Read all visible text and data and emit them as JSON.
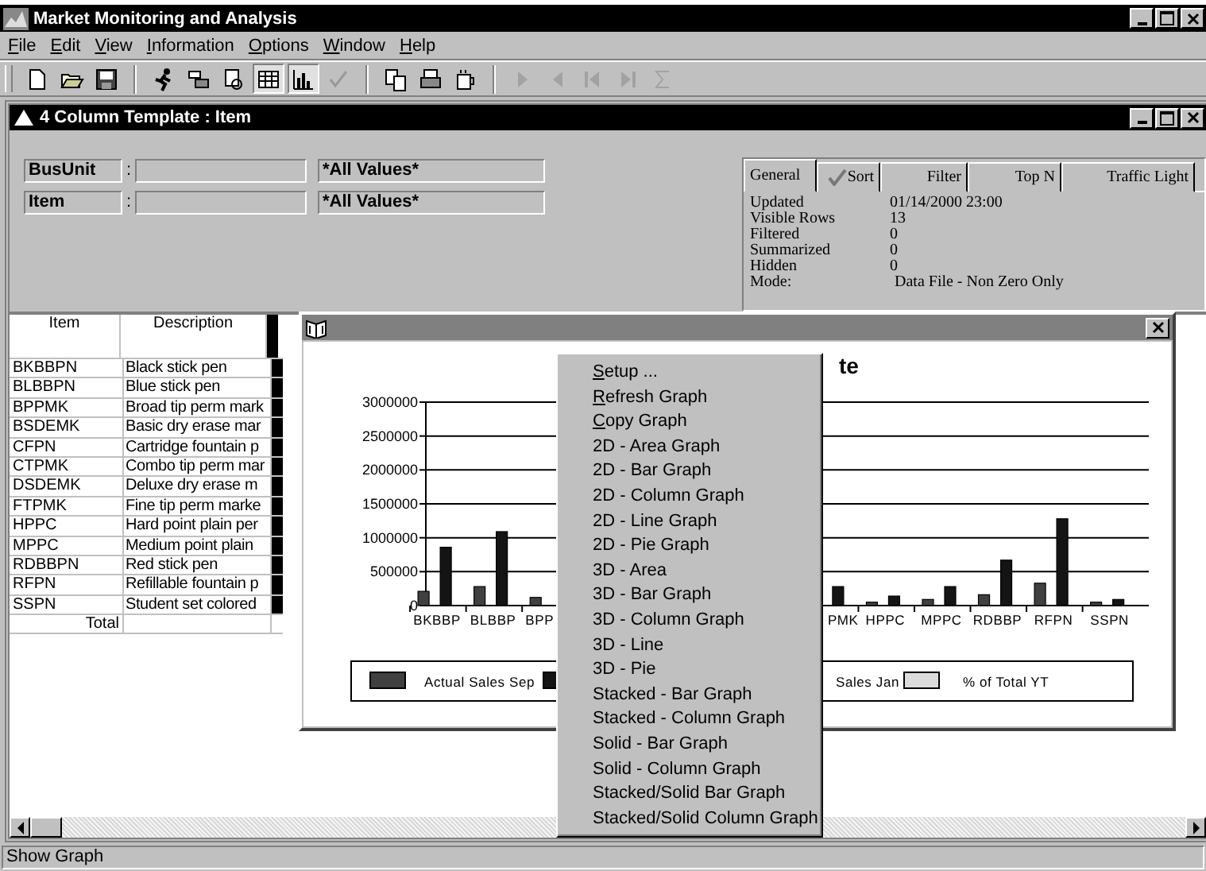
{
  "window": {
    "title": "Market Monitoring and Analysis"
  },
  "menu": [
    "File",
    "Edit",
    "View",
    "Information",
    "Options",
    "Window",
    "Help"
  ],
  "toolbar": [
    [
      {
        "kind": "new",
        "pressed": false,
        "disabled": false
      },
      {
        "kind": "open",
        "pressed": false,
        "disabled": false
      },
      {
        "kind": "save",
        "pressed": false,
        "disabled": false
      }
    ],
    [
      {
        "kind": "runner",
        "pressed": false,
        "disabled": false
      },
      {
        "kind": "tiles",
        "pressed": false,
        "disabled": false
      },
      {
        "kind": "form",
        "pressed": false,
        "disabled": false
      },
      {
        "kind": "table",
        "pressed": true,
        "disabled": false
      },
      {
        "kind": "chart",
        "pressed": true,
        "disabled": false
      },
      {
        "kind": "check",
        "pressed": false,
        "disabled": false
      }
    ],
    [
      {
        "kind": "copy",
        "pressed": false,
        "disabled": false
      },
      {
        "kind": "print",
        "pressed": false,
        "disabled": false
      },
      {
        "kind": "cup",
        "pressed": false,
        "disabled": false
      }
    ],
    [
      {
        "kind": "play",
        "pressed": false,
        "disabled": true
      },
      {
        "kind": "back",
        "pressed": false,
        "disabled": true
      },
      {
        "kind": "first",
        "pressed": false,
        "disabled": true
      },
      {
        "kind": "last",
        "pressed": false,
        "disabled": true
      },
      {
        "kind": "sum",
        "pressed": false,
        "disabled": true
      }
    ]
  ],
  "document": {
    "title": "4 Column Template : Item",
    "filters": [
      {
        "label": "BusUnit",
        "separator": ":",
        "value": "*All Values*"
      },
      {
        "label": "Item",
        "separator": ":",
        "value": "*All Values*"
      }
    ],
    "info_tabs": [
      {
        "label": "General",
        "selected": true,
        "kind": "plain"
      },
      {
        "label": "Sort",
        "selected": false,
        "kind": "checked"
      },
      {
        "label": "Filter",
        "selected": false,
        "kind": "plain"
      },
      {
        "label": "Top N",
        "selected": false,
        "kind": "plain"
      },
      {
        "label": "Traffic Light",
        "selected": false,
        "kind": "plain"
      }
    ],
    "info": [
      {
        "label": "Updated",
        "value": "01/14/2000 23:00"
      },
      {
        "label": "Visible Rows",
        "value": "13"
      },
      {
        "label": "Filtered",
        "value": "0"
      },
      {
        "label": "Summarized",
        "value": "0"
      },
      {
        "label": "Hidden",
        "value": "0"
      },
      {
        "label": "Mode:",
        "value": "Data File - Non Zero Only"
      }
    ],
    "table": {
      "columns": [
        "Item",
        "Description"
      ],
      "rows": [
        {
          "item": "BKBBPN",
          "description": "Black stick pen"
        },
        {
          "item": "BLBBPN",
          "description": "Blue stick pen"
        },
        {
          "item": "BPPMK",
          "description": "Broad tip perm mark"
        },
        {
          "item": "BSDEMK",
          "description": "Basic dry erase mar"
        },
        {
          "item": "CFPN",
          "description": "Cartridge fountain p"
        },
        {
          "item": "CTPMK",
          "description": "Combo tip perm mar"
        },
        {
          "item": "DSDEMK",
          "description": "Deluxe dry erase m"
        },
        {
          "item": "FTPMK",
          "description": "Fine tip perm marke"
        },
        {
          "item": "HPPC",
          "description": "Hard point plain per"
        },
        {
          "item": "MPPC",
          "description": "Medium point plain"
        },
        {
          "item": "RDBBPN",
          "description": "Red stick pen"
        },
        {
          "item": "RFPN",
          "description": "Refillable fountain p"
        },
        {
          "item": "SSPN",
          "description": "Student set colored"
        }
      ],
      "total_label": "Total"
    }
  },
  "graph": {
    "chart_data": {
      "type": "bar",
      "title": "te",
      "grid": true,
      "categories": [
        "BKBBP",
        "BLBBP",
        "BPP",
        null,
        null,
        null,
        null,
        "PMK",
        "HPPC",
        "MPPC",
        "RDBBP",
        "RFPN",
        "SSPN"
      ],
      "ylim": [
        0,
        3000000
      ],
      "yticks": [
        0,
        500000,
        1000000,
        1500000,
        2000000,
        2500000,
        3000000
      ],
      "series": [
        {
          "name": "Actual Sales Sep",
          "color": "#404040",
          "values": [
            210000,
            280000,
            120000,
            null,
            null,
            null,
            null,
            null,
            50000,
            90000,
            160000,
            330000,
            50000
          ]
        },
        {
          "name": "Sales Jan",
          "color": "#141414",
          "values": [
            860000,
            1090000,
            null,
            null,
            null,
            null,
            null,
            280000,
            140000,
            280000,
            670000,
            1280000,
            90000
          ]
        },
        {
          "name": "% of Total YT",
          "color": "#dcdcdc",
          "values": [
            null,
            null,
            null,
            null,
            null,
            null,
            null,
            null,
            null,
            null,
            null,
            null,
            null
          ]
        }
      ]
    }
  },
  "context_menu": [
    {
      "label": "Setup ...",
      "mnemonic": true
    },
    {
      "label": "Refresh Graph",
      "mnemonic": true
    },
    {
      "label": "Copy Graph",
      "mnemonic": true
    },
    {
      "label": "2D - Area Graph",
      "mnemonic": false
    },
    {
      "label": "2D - Bar Graph",
      "mnemonic": false
    },
    {
      "label": "2D - Column Graph",
      "mnemonic": false
    },
    {
      "label": "2D - Line Graph",
      "mnemonic": false
    },
    {
      "label": "2D - Pie Graph",
      "mnemonic": false
    },
    {
      "label": "3D - Area",
      "mnemonic": false
    },
    {
      "label": "3D - Bar Graph",
      "mnemonic": false
    },
    {
      "label": "3D - Column Graph",
      "mnemonic": false
    },
    {
      "label": "3D - Line",
      "mnemonic": false
    },
    {
      "label": "3D - Pie",
      "mnemonic": false
    },
    {
      "label": "Stacked - Bar Graph",
      "mnemonic": false
    },
    {
      "label": "Stacked - Column Graph",
      "mnemonic": false
    },
    {
      "label": "Solid - Bar Graph",
      "mnemonic": false
    },
    {
      "label": "Solid - Column Graph",
      "mnemonic": false
    },
    {
      "label": "Stacked/Solid Bar Graph",
      "mnemonic": false
    },
    {
      "label": "Stacked/Solid Column Graph",
      "mnemonic": false
    }
  ],
  "status_bar": "Show Graph"
}
